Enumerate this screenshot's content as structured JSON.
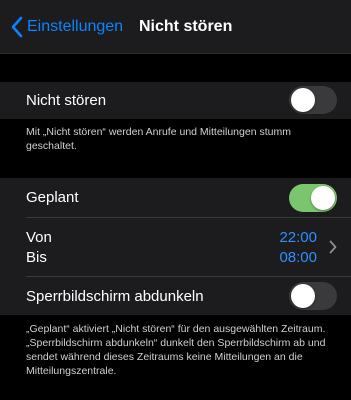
{
  "navbar": {
    "back_label": "Einstellungen",
    "title": "Nicht stören"
  },
  "dnd": {
    "label": "Nicht stören",
    "enabled": false,
    "footer": "Mit „Nicht stören“ werden Anrufe und Mitteilungen stumm geschaltet."
  },
  "scheduled": {
    "label": "Geplant",
    "enabled": true,
    "from_label": "Von",
    "from_time": "22:00",
    "to_label": "Bis",
    "to_time": "08:00"
  },
  "dim_lock": {
    "label": "Sperrbildschirm abdunkeln",
    "enabled": false,
    "footer": "„Geplant“ aktiviert „Nicht stören“ für den ausgewählten Zeitraum. „Sperrbildschirm abdunkeln“ dunkelt den Sperrbildschirm ab und sendet während dieses Zeitraums keine Mitteilungen an die Mitteilungszentrale."
  },
  "colors": {
    "accent": "#0a84ff",
    "toggle_on": "#7ac56d",
    "cell_bg": "#1c1c1e"
  }
}
